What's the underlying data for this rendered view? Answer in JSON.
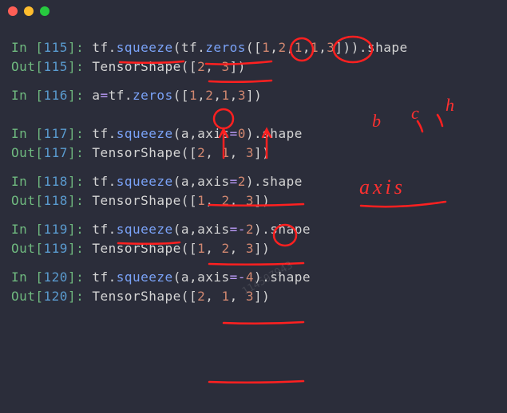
{
  "cells": [
    {
      "in_num": "115",
      "in_code": "tf.squeeze(tf.zeros([1,2,1,1,3])).shape",
      "out_num": "115",
      "out_code": "TensorShape([2, 3])"
    },
    {
      "in_num": "116",
      "in_code": "a=tf.zeros([1,2,1,3])",
      "out_num": null,
      "out_code": null
    },
    {
      "in_num": "117",
      "in_code": "tf.squeeze(a,axis=0).shape",
      "out_num": "117",
      "out_code": "TensorShape([2, 1, 3])"
    },
    {
      "in_num": "118",
      "in_code": "tf.squeeze(a,axis=2).shape",
      "out_num": "118",
      "out_code": "TensorShape([1, 2, 3])"
    },
    {
      "in_num": "119",
      "in_code": "tf.squeeze(a,axis=-2).shape",
      "out_num": "119",
      "out_code": "TensorShape([1, 2, 3])"
    },
    {
      "in_num": "120",
      "in_code": "tf.squeeze(a,axis=-4).shape",
      "out_num": "120",
      "out_code": "TensorShape([2, 1, 3])"
    }
  ],
  "annot": {
    "b": "b",
    "c": "c",
    "h": "h",
    "axis": "axis"
  },
  "watermark": "114597943"
}
